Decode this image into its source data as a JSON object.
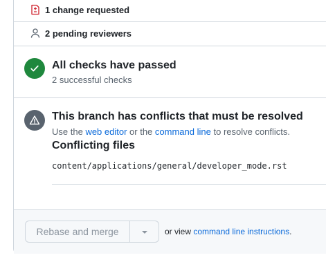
{
  "review_rows": {
    "change_requested": {
      "label": "1 change requested",
      "icon": "file-diff-icon"
    },
    "pending_reviewers": {
      "label": "2 pending reviewers",
      "icon": "person-icon"
    }
  },
  "checks": {
    "title": "All checks have passed",
    "subtitle": "2 successful checks",
    "icon": "check-icon",
    "color": "#1f883d"
  },
  "conflicts": {
    "title": "This branch has conflicts that must be resolved",
    "desc_prefix": "Use the",
    "web_editor_link": "web editor",
    "desc_middle": "or the",
    "command_line_link": "command line",
    "desc_suffix": "to resolve conflicts.",
    "icon": "alert-icon",
    "color": "#59636e",
    "files_heading": "Conflicting files",
    "files": [
      "content/applications/general/developer_mode.rst"
    ]
  },
  "merge": {
    "button_label": "Rebase and merge",
    "or_view_text": "or view",
    "instructions_link": "command line instructions",
    "trailing": "."
  },
  "colors": {
    "link": "#0969da",
    "danger": "#cf222e",
    "border": "#d0d7de"
  }
}
